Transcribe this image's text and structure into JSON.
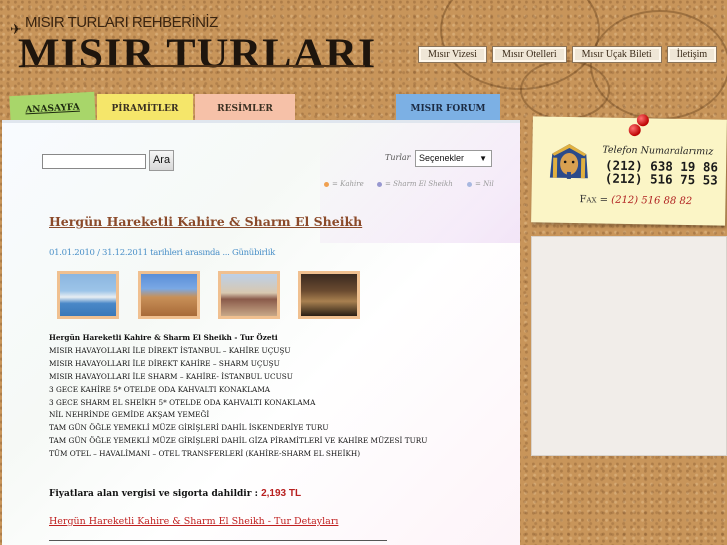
{
  "header": {
    "tagline": "MISIR TURLARI REHBERİNİZ",
    "logo": "MISIR TURLARI"
  },
  "topnav": [
    {
      "label": "Mısır Vizesi"
    },
    {
      "label": "Mısır Otelleri"
    },
    {
      "label": "Mısır Uçak Bileti"
    },
    {
      "label": "İletişim"
    }
  ],
  "tabs": {
    "home": "ANASAYFA",
    "pyramids": "PİRAMİTLER",
    "images": "RESİMLER",
    "forum": "MISIR FORUM"
  },
  "search": {
    "value": "",
    "button_label": "Ara",
    "tours_label": "Turlar",
    "tours_selected": "Seçenekler"
  },
  "legend": [
    {
      "label": "= Kahire",
      "color": "#f0a050"
    },
    {
      "label": "= Sharm El Sheikh",
      "color": "#9898d0"
    },
    {
      "label": "= Nil",
      "color": "#a8b8e0"
    }
  ],
  "tour": {
    "title": "Hergün Hareketli Kahire & Sharm El Sheikh",
    "date_line": "01.01.2010 / 31.12.2011 tarihleri arasında ... Günübirlik",
    "summary_title": "Hergün Hareketli Kahire & Sharm El Sheikh - Tur Özeti",
    "summary_lines": [
      "MISIR HAVAYOLLARI İLE DİREKT İSTANBUL – KAHİRE UÇUŞU",
      "MISIR HAVAYOLLARI İLE DİREKT KAHİRE – SHARM UÇUŞU",
      "MISIR HAVAYOLLARI İLE SHARM – KAHİRE- İSTANBUL UCUSU",
      "3 GECE KAHİRE 5* OTELDE ODA KAHVALTI KONAKLAMA",
      "3 GECE SHARM EL SHEİKH 5* OTELDE ODA KAHVALTI KONAKLAMA",
      "NİL NEHRİNDE GEMİDE AKŞAM YEMEĞİ",
      "TAM GÜN ÖĞLE YEMEKLİ MÜZE GİRİŞLERİ DAHİL İSKENDERİYE TURU",
      "TAM GÜN ÖĞLE YEMEKLİ MÜZE GİRİŞLERİ DAHİL GİZA PİRAMİTLERİ VE KAHİRE MÜZESİ TURU",
      "TÜM OTEL – HAVALİMANI – OTEL TRANSFERLERİ (KAHİRE-SHARM EL SHEİKH)"
    ],
    "price_text": "Fiyatlara alan vergisi ve sigorta dahildir :",
    "price_value": "2,193 TL",
    "detail_link": "Hergün Hareketli Kahire & Sharm El Sheikh - Tur Detayları"
  },
  "contact": {
    "phone_label": "Telefon Numaralarımız",
    "phone1": "(212) 638 19 86",
    "phone2": "(212) 516 75 53",
    "fax_label": "Fax =",
    "fax_number": "(212) 516 88 82"
  }
}
